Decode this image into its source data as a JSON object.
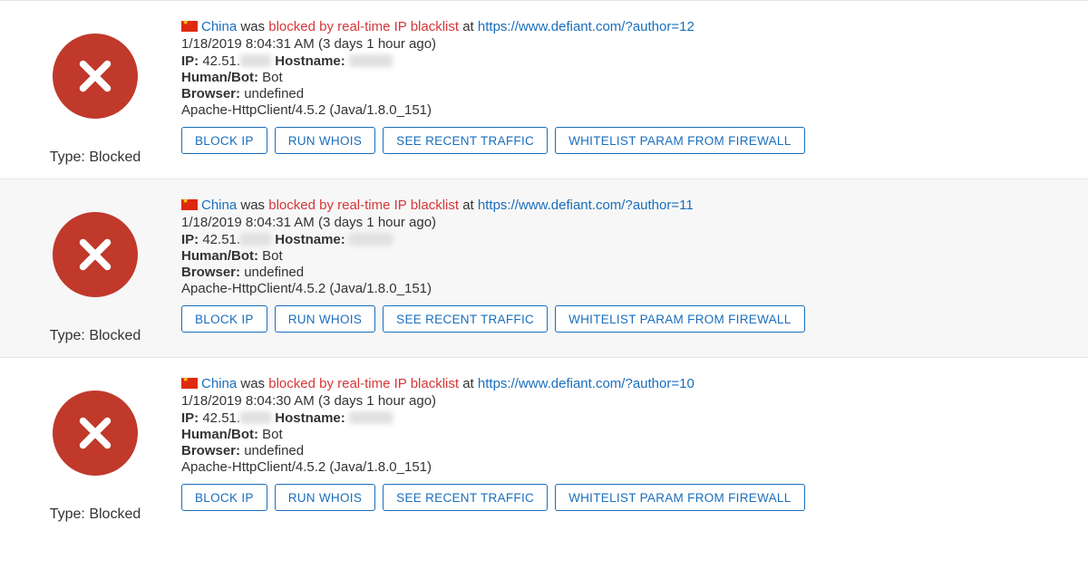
{
  "labels": {
    "type": "Type:",
    "ip": "IP:",
    "hostname": "Hostname:",
    "humanbot": "Human/Bot:",
    "browser": "Browser:",
    "was": "was",
    "at": "at"
  },
  "buttons": {
    "block_ip": "BLOCK IP",
    "run_whois": "RUN WHOIS",
    "see_recent": "SEE RECENT TRAFFIC",
    "whitelist": "WHITELIST PARAM FROM FIREWALL"
  },
  "entries": [
    {
      "type_value": "Blocked",
      "country": "China",
      "reason": "blocked by real-time IP blacklist",
      "url": "https://www.defiant.com/?author=12",
      "timestamp": "1/18/2019 8:04:31 AM (3 days 1 hour ago)",
      "ip_prefix": "42.51.",
      "humanbot": "Bot",
      "browser": "undefined",
      "ua": "Apache-HttpClient/4.5.2 (Java/1.8.0_151)"
    },
    {
      "type_value": "Blocked",
      "country": "China",
      "reason": "blocked by real-time IP blacklist",
      "url": "https://www.defiant.com/?author=11",
      "timestamp": "1/18/2019 8:04:31 AM (3 days 1 hour ago)",
      "ip_prefix": "42.51.",
      "humanbot": "Bot",
      "browser": "undefined",
      "ua": "Apache-HttpClient/4.5.2 (Java/1.8.0_151)"
    },
    {
      "type_value": "Blocked",
      "country": "China",
      "reason": "blocked by real-time IP blacklist",
      "url": "https://www.defiant.com/?author=10",
      "timestamp": "1/18/2019 8:04:30 AM (3 days 1 hour ago)",
      "ip_prefix": "42.51.",
      "humanbot": "Bot",
      "browser": "undefined",
      "ua": "Apache-HttpClient/4.5.2 (Java/1.8.0_151)"
    }
  ]
}
